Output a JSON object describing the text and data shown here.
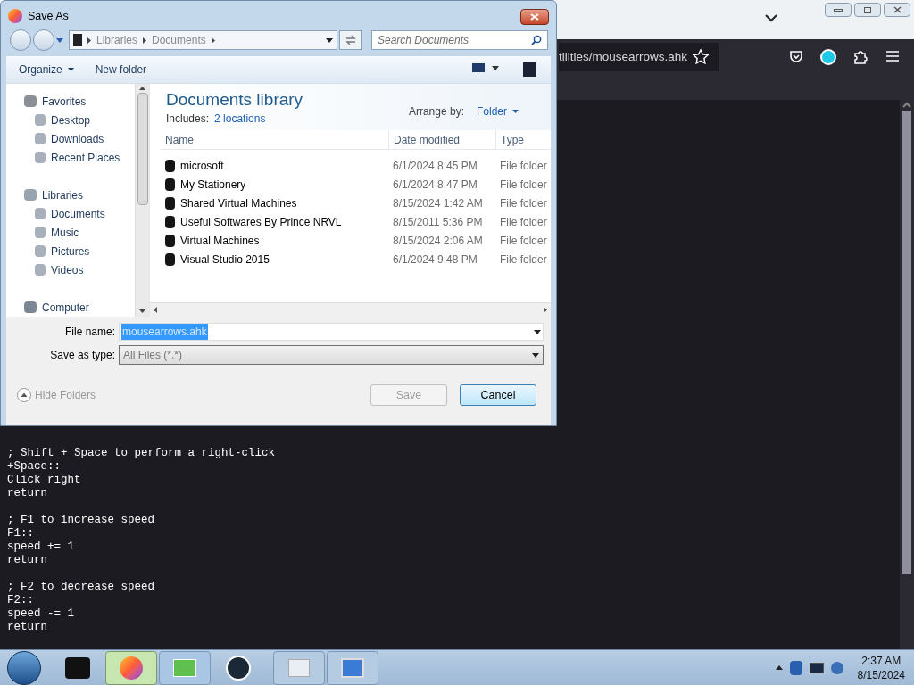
{
  "browser": {
    "url": "tilities/mousearrows.ahk",
    "code_blocks": [
      [
        "; Shift + Space to perform a right-click",
        "+Space::",
        "Click right",
        "return"
      ],
      [
        "; F1 to increase speed",
        "F1::",
        "speed += 1",
        "return"
      ],
      [
        "; F2 to decrease speed",
        "F2::",
        "speed -= 1",
        "return"
      ]
    ]
  },
  "dialog": {
    "title": "Save As",
    "address_path": [
      "Libraries",
      "Documents"
    ],
    "search": {
      "placeholder": "Search Documents"
    },
    "toolbar": [
      "Organize",
      "New folder"
    ],
    "nav": [
      {
        "label": "Favorites",
        "children": [
          {
            "label": "Desktop"
          },
          {
            "label": "Downloads"
          },
          {
            "label": "Recent Places"
          }
        ]
      },
      {
        "label": "Libraries",
        "children": [
          {
            "label": "Documents"
          },
          {
            "label": "Music"
          },
          {
            "label": "Pictures"
          },
          {
            "label": "Videos"
          }
        ]
      },
      {
        "label": "Computer"
      }
    ],
    "library": {
      "title": "Documents library",
      "includes_label": "Includes:",
      "includes_link": "2 locations",
      "arrange_label": "Arrange by:",
      "arrange_value": "Folder"
    },
    "columns": [
      "Name",
      "Date modified",
      "Type"
    ],
    "rows": [
      {
        "name": "microsoft",
        "date": "6/1/2024 8:45 PM",
        "type": "File folder"
      },
      {
        "name": "My Stationery",
        "date": "6/1/2024 8:47 PM",
        "type": "File folder"
      },
      {
        "name": "Shared Virtual Machines",
        "date": "8/15/2024 1:42 AM",
        "type": "File folder"
      },
      {
        "name": "Useful Softwares By Prince NRVL",
        "date": "8/15/2011 5:36 PM",
        "type": "File folder"
      },
      {
        "name": "Virtual Machines",
        "date": "8/15/2024 2:06 AM",
        "type": "File folder"
      },
      {
        "name": "Visual Studio 2015",
        "date": "6/1/2024 9:48 PM",
        "type": "File folder"
      }
    ],
    "file_name_label": "File name:",
    "file_name": "mousearrows.ahk",
    "type_label": "Save as type:",
    "save_type": "All Files (*.*)",
    "hide_folders": "Hide Folders",
    "buttons": [
      {
        "label": "Save",
        "disabled": true
      },
      {
        "label": "Cancel",
        "disabled": false
      }
    ]
  },
  "taskbar": {
    "time": "2:37 AM",
    "date": "8/15/2024"
  }
}
